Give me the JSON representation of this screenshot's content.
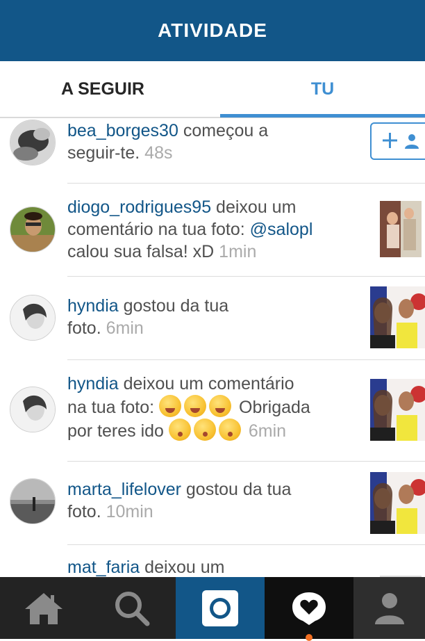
{
  "header": {
    "title": "ATIVIDADE"
  },
  "tabs": {
    "following": "A SEGUIR",
    "you": "TU"
  },
  "feed": {
    "items": [
      {
        "user": "bea_borges30",
        "text1": " começou a",
        "text2": "seguir-te.",
        "time": "48s"
      },
      {
        "user": "diogo_rodrigues95",
        "text1": " deixou um",
        "text2": "comentário na tua foto: ",
        "mention": "@salopl",
        "text3": "calou sua falsa! xD ",
        "time": "1min"
      },
      {
        "user": "hyndia",
        "text1": " gostou da tua",
        "text2": "foto.",
        "time": "6min"
      },
      {
        "user": "hyndia",
        "text1": " deixou um comentário",
        "text2": "na tua foto: ",
        "text2b": " Obrigada",
        "text3": "por teres ido ",
        "time": "6min"
      },
      {
        "user": "marta_lifelover",
        "text1": " gostou da tua",
        "text2": "foto.",
        "time": "10min"
      },
      {
        "user": "mat_faria",
        "text1": " deixou um"
      }
    ]
  },
  "nav": {
    "icons": [
      "home-icon",
      "search-icon",
      "camera-icon",
      "activity-icon",
      "profile-icon"
    ]
  },
  "colors": {
    "brand": "#125688",
    "accent": "#3f8fd2",
    "nav_bg": "#232323",
    "notification": "#f26f22"
  }
}
